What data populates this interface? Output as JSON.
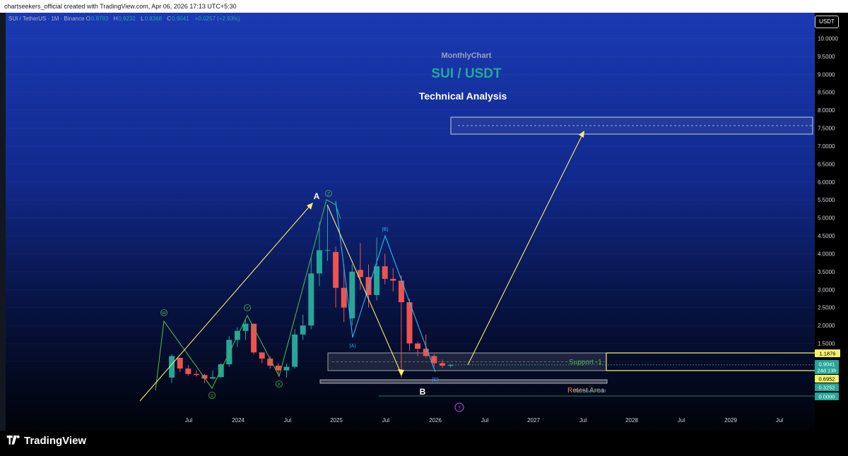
{
  "header": {
    "attribution": "chartseekers_official created with TradingView.com, Apr 06, 2026 17:13 UTC+5:30"
  },
  "legend": {
    "symbol": "SUI / TetherUS · 1M · Binance",
    "open_label": "O",
    "open": "0.8783",
    "high_label": "H",
    "high": "0.9232",
    "low_label": "L",
    "low": "0.8368",
    "close_label": "C",
    "close": "0.9041",
    "change": "+0.0257 (+2.93%)"
  },
  "currency_badge": "USDT",
  "titles": {
    "sub": "MonthlyChart",
    "main": "SUI / USDT",
    "analysis": "Technical Analysis"
  },
  "colors": {
    "up": "#26a69a",
    "down": "#ef5350",
    "projection": "#f5f06a",
    "wave_green": "#4caf50",
    "wave_blue": "#29b6f6"
  },
  "annotations": {
    "wave_labels": [
      "W",
      "X",
      "Y",
      "X",
      "Z",
      "(A)",
      "(B)",
      "(C)"
    ],
    "point_a": "A",
    "point_b": "B",
    "support": "Support -1",
    "retest": "Retest Area",
    "retest_overlay": "Reversal Point"
  },
  "price_tags": {
    "resistance": "1.1876",
    "current": "0.9041",
    "countdown": "24d 13h",
    "support_low": "0.6952",
    "retest": "0.3252",
    "zero": "0.0000"
  },
  "footer": {
    "brand": "TradingView"
  },
  "chart_data": {
    "type": "candlestick",
    "interval": "1M",
    "x_axis_labels": [
      "Jul",
      "2024",
      "Jul",
      "2025",
      "Jul",
      "2026",
      "Jul",
      "2027",
      "Jul",
      "2028",
      "Jul",
      "2029",
      "Jul"
    ],
    "y_axis_ticks": [
      10.0,
      9.5,
      9.0,
      8.5,
      8.0,
      7.5,
      7.0,
      6.5,
      6.0,
      5.5,
      5.0,
      4.5,
      4.0,
      3.5,
      3.0,
      2.5,
      2.0,
      1.5,
      1.0
    ],
    "y_axis_labels": [
      "10.0000",
      "9.5000",
      "9.0000",
      "8.5000",
      "8.0000",
      "7.5000",
      "7.0000",
      "6.5000",
      "6.0000",
      "5.5000",
      "5.0000",
      "4.5000",
      "4.0000",
      "3.5000",
      "3.0000",
      "2.5000",
      "2.0000",
      "1.5000"
    ],
    "ylim": [
      0,
      10.5
    ],
    "candles": [
      {
        "date": "2023-05",
        "o": 0.0,
        "h": 0.0,
        "l": 0.0,
        "c": 0.0
      },
      {
        "date": "2023-06",
        "o": 0.55,
        "h": 1.2,
        "l": 0.4,
        "c": 1.15
      },
      {
        "date": "2023-07",
        "o": 1.1,
        "h": 1.1,
        "l": 0.7,
        "c": 0.8
      },
      {
        "date": "2023-08",
        "o": 0.8,
        "h": 0.9,
        "l": 0.6,
        "c": 0.65
      },
      {
        "date": "2023-09",
        "o": 0.65,
        "h": 0.75,
        "l": 0.58,
        "c": 0.62
      },
      {
        "date": "2023-10",
        "o": 0.62,
        "h": 0.65,
        "l": 0.4,
        "c": 0.52
      },
      {
        "date": "2023-11",
        "o": 0.52,
        "h": 0.75,
        "l": 0.5,
        "c": 0.56
      },
      {
        "date": "2023-12",
        "o": 0.56,
        "h": 0.95,
        "l": 0.55,
        "c": 0.92
      },
      {
        "date": "2024-01",
        "o": 0.92,
        "h": 1.7,
        "l": 0.85,
        "c": 1.6
      },
      {
        "date": "2024-02",
        "o": 1.6,
        "h": 1.95,
        "l": 1.4,
        "c": 1.85
      },
      {
        "date": "2024-03",
        "o": 1.85,
        "h": 2.15,
        "l": 1.6,
        "c": 2.05
      },
      {
        "date": "2024-04",
        "o": 2.05,
        "h": 2.0,
        "l": 1.2,
        "c": 1.25
      },
      {
        "date": "2024-05",
        "o": 1.25,
        "h": 1.2,
        "l": 0.95,
        "c": 1.08
      },
      {
        "date": "2024-06",
        "o": 1.08,
        "h": 1.15,
        "l": 0.8,
        "c": 0.88
      },
      {
        "date": "2024-07",
        "o": 0.88,
        "h": 0.95,
        "l": 0.6,
        "c": 0.75
      },
      {
        "date": "2024-08",
        "o": 0.75,
        "h": 0.95,
        "l": 0.55,
        "c": 0.85
      },
      {
        "date": "2024-09",
        "o": 0.85,
        "h": 1.9,
        "l": 0.8,
        "c": 1.75
      },
      {
        "date": "2024-10",
        "o": 1.75,
        "h": 2.3,
        "l": 1.6,
        "c": 2.0
      },
      {
        "date": "2024-11",
        "o": 2.0,
        "h": 3.9,
        "l": 1.9,
        "c": 3.45
      },
      {
        "date": "2024-12",
        "o": 3.45,
        "h": 4.9,
        "l": 3.1,
        "c": 4.1
      },
      {
        "date": "2025-01",
        "o": 4.1,
        "h": 5.35,
        "l": 3.8,
        "c": 4.1
      },
      {
        "date": "2025-02",
        "o": 4.05,
        "h": 4.2,
        "l": 2.5,
        "c": 3.05
      },
      {
        "date": "2025-03",
        "o": 3.05,
        "h": 3.7,
        "l": 2.1,
        "c": 2.5
      },
      {
        "date": "2025-04",
        "o": 2.2,
        "h": 3.7,
        "l": 2.0,
        "c": 3.5
      },
      {
        "date": "2025-05",
        "o": 3.55,
        "h": 4.3,
        "l": 3.0,
        "c": 3.35
      },
      {
        "date": "2025-06",
        "o": 3.35,
        "h": 3.7,
        "l": 2.5,
        "c": 2.85
      },
      {
        "date": "2025-07",
        "o": 2.85,
        "h": 4.45,
        "l": 2.7,
        "c": 3.65
      },
      {
        "date": "2025-08",
        "o": 3.65,
        "h": 4.0,
        "l": 3.15,
        "c": 3.3
      },
      {
        "date": "2025-09",
        "o": 3.3,
        "h": 3.6,
        "l": 2.95,
        "c": 3.25
      },
      {
        "date": "2025-10",
        "o": 3.25,
        "h": 3.4,
        "l": 0.55,
        "c": 2.65
      },
      {
        "date": "2025-11",
        "o": 2.65,
        "h": 2.75,
        "l": 1.3,
        "c": 1.5
      },
      {
        "date": "2025-12",
        "o": 1.5,
        "h": 1.55,
        "l": 1.15,
        "c": 1.35
      },
      {
        "date": "2026-01",
        "o": 1.35,
        "h": 1.75,
        "l": 1.1,
        "c": 1.15
      },
      {
        "date": "2026-02",
        "o": 1.15,
        "h": 1.2,
        "l": 0.85,
        "c": 0.95
      },
      {
        "date": "2026-03",
        "o": 0.95,
        "h": 1.05,
        "l": 0.82,
        "c": 0.88
      },
      {
        "date": "2026-04",
        "o": 0.8783,
        "h": 0.9232,
        "l": 0.8368,
        "c": 0.9041
      }
    ]
  }
}
